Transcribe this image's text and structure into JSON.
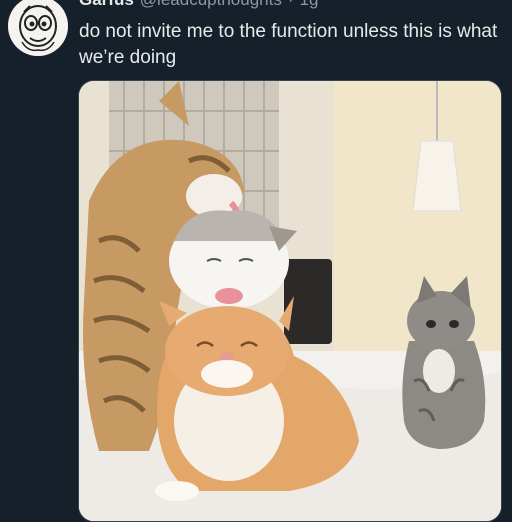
{
  "tweet": {
    "display_name": "Garfus",
    "handle": "@leadcupthoughts",
    "separator": "·",
    "time": "1g",
    "text": "do not invite me to the function unless this is what we’re doing",
    "more_icon": "more-horizontal-icon"
  },
  "media": {
    "description": "photo of four cats"
  },
  "colors": {
    "background": "#15202b",
    "primary_text": "#e7e9ea",
    "secondary_text": "#8b98a5"
  }
}
